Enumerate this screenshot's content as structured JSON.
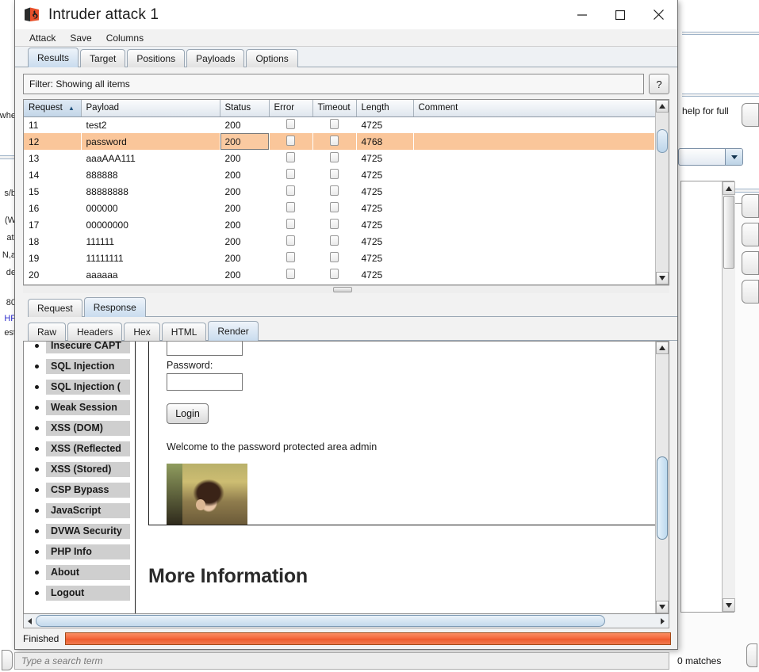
{
  "window": {
    "title": "Intruder attack 1",
    "logo_icon": "burp-cube-icon",
    "minimize_label": "–",
    "maximize_label": "□",
    "close_label": "✕"
  },
  "menubar": {
    "items": [
      {
        "label": "Attack"
      },
      {
        "label": "Save"
      },
      {
        "label": "Columns"
      }
    ]
  },
  "tabs": {
    "items": [
      {
        "label": "Results",
        "active": true
      },
      {
        "label": "Target",
        "active": false
      },
      {
        "label": "Positions",
        "active": false
      },
      {
        "label": "Payloads",
        "active": false
      },
      {
        "label": "Options",
        "active": false
      }
    ]
  },
  "filter": {
    "text": "Filter: Showing all items",
    "help_label": "?",
    "help_icon": "question-mark-icon"
  },
  "results_table": {
    "columns": [
      {
        "label": "Request",
        "sorted": true,
        "sort_icon": "sort-ascending-icon"
      },
      {
        "label": "Payload",
        "sorted": false
      },
      {
        "label": "Status",
        "sorted": false
      },
      {
        "label": "Error",
        "sorted": false
      },
      {
        "label": "Timeout",
        "sorted": false
      },
      {
        "label": "Length",
        "sorted": false
      },
      {
        "label": "Comment",
        "sorted": false
      }
    ],
    "rows": [
      {
        "request": "11",
        "payload": "test2",
        "status": "200",
        "error": false,
        "timeout": false,
        "length": "4725",
        "comment": "",
        "highlighted": false
      },
      {
        "request": "12",
        "payload": "password",
        "status": "200",
        "error": false,
        "timeout": false,
        "length": "4768",
        "comment": "",
        "highlighted": true
      },
      {
        "request": "13",
        "payload": "aaaAAA111",
        "status": "200",
        "error": false,
        "timeout": false,
        "length": "4725",
        "comment": "",
        "highlighted": false
      },
      {
        "request": "14",
        "payload": "888888",
        "status": "200",
        "error": false,
        "timeout": false,
        "length": "4725",
        "comment": "",
        "highlighted": false
      },
      {
        "request": "15",
        "payload": "88888888",
        "status": "200",
        "error": false,
        "timeout": false,
        "length": "4725",
        "comment": "",
        "highlighted": false
      },
      {
        "request": "16",
        "payload": "000000",
        "status": "200",
        "error": false,
        "timeout": false,
        "length": "4725",
        "comment": "",
        "highlighted": false
      },
      {
        "request": "17",
        "payload": "00000000",
        "status": "200",
        "error": false,
        "timeout": false,
        "length": "4725",
        "comment": "",
        "highlighted": false
      },
      {
        "request": "18",
        "payload": "111111",
        "status": "200",
        "error": false,
        "timeout": false,
        "length": "4725",
        "comment": "",
        "highlighted": false
      },
      {
        "request": "19",
        "payload": "11111111",
        "status": "200",
        "error": false,
        "timeout": false,
        "length": "4725",
        "comment": "",
        "highlighted": false
      },
      {
        "request": "20",
        "payload": "aaaaaa",
        "status": "200",
        "error": false,
        "timeout": false,
        "length": "4725",
        "comment": "",
        "highlighted": false
      }
    ]
  },
  "message_tabs": {
    "items": [
      {
        "label": "Request",
        "active": false
      },
      {
        "label": "Response",
        "active": true
      }
    ]
  },
  "view_tabs": {
    "items": [
      {
        "label": "Raw",
        "active": false
      },
      {
        "label": "Headers",
        "active": false
      },
      {
        "label": "Hex",
        "active": false
      },
      {
        "label": "HTML",
        "active": false
      },
      {
        "label": "Render",
        "active": true
      }
    ]
  },
  "rendered_page": {
    "sidebar_items": [
      {
        "label": "Insecure CAPT"
      },
      {
        "label": "SQL Injection"
      },
      {
        "label": "SQL Injection ("
      },
      {
        "label": "Weak Session "
      },
      {
        "label": "XSS (DOM)"
      },
      {
        "label": "XSS (Reflected"
      },
      {
        "label": "XSS (Stored)"
      },
      {
        "label": "CSP Bypass"
      },
      {
        "label": "JavaScript"
      },
      {
        "label": "DVWA Security"
      },
      {
        "label": "PHP Info"
      },
      {
        "label": "About"
      },
      {
        "label": "Logout"
      }
    ],
    "password_label": "Password:",
    "username_value": "",
    "password_value": "",
    "login_button": "Login",
    "welcome_text": "Welcome to the password protected area admin",
    "photo_alt": "surprised-face-photo",
    "more_information_heading": "More Information"
  },
  "status": {
    "label": "Finished",
    "progress_percent": 100,
    "progress_color": "#f4673c"
  },
  "search": {
    "placeholder": "Type a search term",
    "value": "",
    "matches": "0 matches"
  },
  "background": {
    "left_fragments": [
      "/whe",
      "s/b",
      "(W",
      "ati",
      "N,a",
      "de",
      "80",
      "HF",
      "est"
    ],
    "right_text": "help for full"
  }
}
